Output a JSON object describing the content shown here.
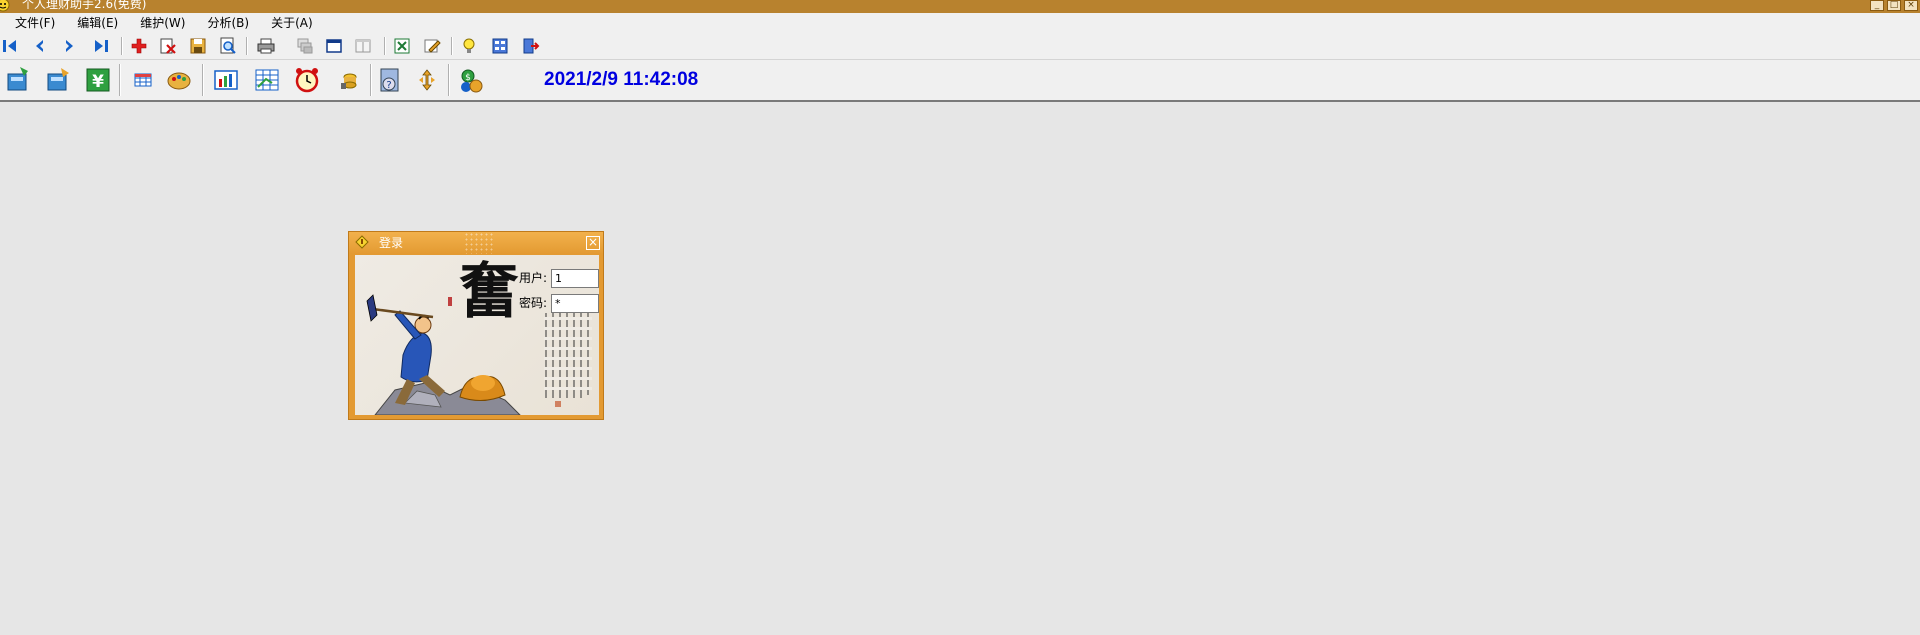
{
  "window": {
    "title": "个人理财助手2.6(免费)",
    "controls": [
      "_",
      "□",
      "×"
    ]
  },
  "menu": [
    {
      "label": "文件(F)"
    },
    {
      "label": "编辑(E)"
    },
    {
      "label": "维护(W)"
    },
    {
      "label": "分析(B)"
    },
    {
      "label": "关于(A)"
    }
  ],
  "toolbar1": {
    "icons": [
      "first-record-icon",
      "prev-record-icon",
      "next-record-icon",
      "last-record-icon",
      "add-record-icon",
      "delete-record-icon",
      "save-icon",
      "preview-icon",
      "print-icon",
      "copy-icon",
      "window-icon",
      "columns-icon",
      "excel-export-icon",
      "edit-icon",
      "tip-bulb-icon",
      "calculator-icon",
      "exit-icon"
    ]
  },
  "toolbar2": {
    "icons": [
      "account-icon",
      "transfer-icon",
      "yuan-icon",
      "grid-icon",
      "palette-icon",
      "chart-icon",
      "report-icon",
      "alarm-clock-icon",
      "coins-icon",
      "help-book-icon",
      "arrows-icon",
      "user-money-icon"
    ],
    "clock": "2021/2/9 11:42:08"
  },
  "login": {
    "title": "登录",
    "user_label": "用户:",
    "user_value": "1",
    "password_label": "密码:",
    "password_value": "*",
    "close": "×",
    "calligraphy": "奮"
  },
  "colors": {
    "titlebar": "#b8822e",
    "dialog": "#e39a32",
    "clock": "#0000e0"
  }
}
